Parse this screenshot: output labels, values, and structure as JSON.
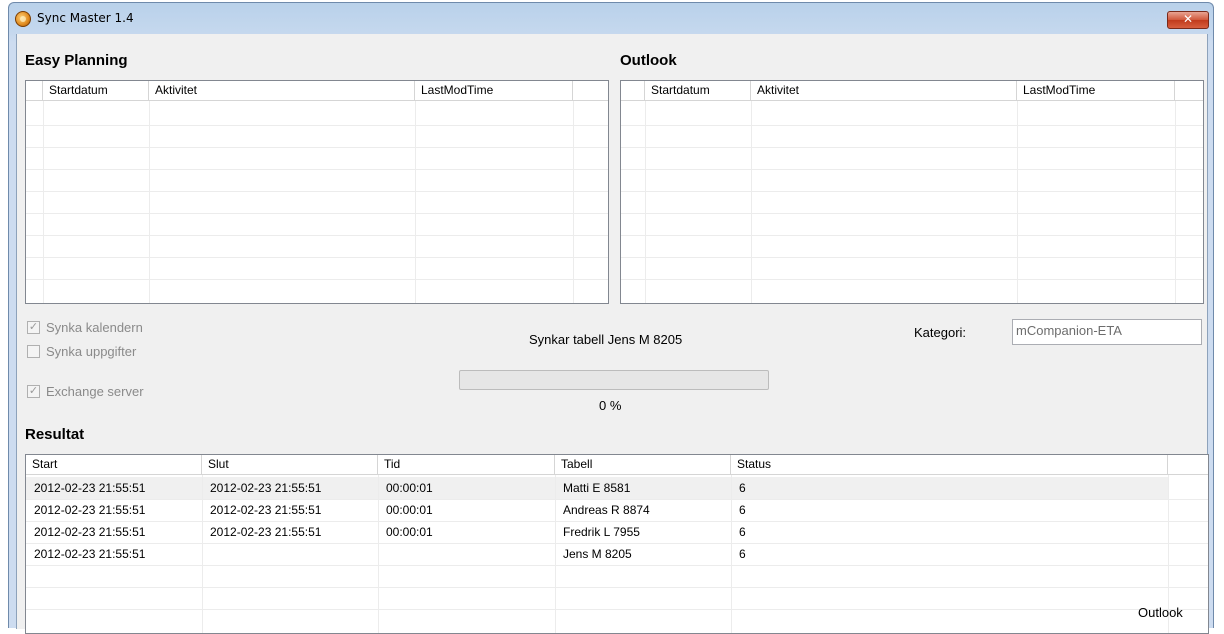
{
  "window": {
    "title": "Sync Master 1.4",
    "close_glyph": "✕"
  },
  "easy_planning": {
    "title": "Easy Planning",
    "columns": [
      "Startdatum",
      "Aktivitet",
      "LastModTime"
    ]
  },
  "outlook": {
    "title": "Outlook",
    "columns": [
      "Startdatum",
      "Aktivitet",
      "LastModTime"
    ]
  },
  "options": {
    "synka_kalendern": {
      "label": "Synka kalendern",
      "checked": true
    },
    "synka_uppgifter": {
      "label": "Synka uppgifter",
      "checked": false
    },
    "exchange_server": {
      "label": "Exchange server",
      "checked": true
    }
  },
  "status": {
    "text": "Synkar tabell Jens M 8205",
    "progress_percent": 0,
    "progress_label": "0 %"
  },
  "kategori": {
    "label": "Kategori:",
    "value": "mCompanion-ETA"
  },
  "resultat": {
    "title": "Resultat",
    "columns": [
      "Start",
      "Slut",
      "Tid",
      "Tabell",
      "Status"
    ],
    "rows": [
      {
        "start": "2012-02-23 21:55:51",
        "slut": "2012-02-23 21:55:51",
        "tid": "00:00:01",
        "tabell": "Matti E 8581",
        "status": "6"
      },
      {
        "start": "2012-02-23 21:55:51",
        "slut": "2012-02-23 21:55:51",
        "tid": "00:00:01",
        "tabell": "Andreas R 8874",
        "status": "6"
      },
      {
        "start": "2012-02-23 21:55:51",
        "slut": "2012-02-23 21:55:51",
        "tid": "00:00:01",
        "tabell": "Fredrik L 7955",
        "status": "6"
      },
      {
        "start": "2012-02-23 21:55:51",
        "slut": "",
        "tid": "",
        "tabell": "Jens M 8205",
        "status": "6"
      }
    ]
  },
  "footer": {
    "text": "Outlook"
  },
  "colors": {
    "title_bar": "#c5d8ee",
    "close_button": "#c9452a",
    "client_bg": "#f0f0f0"
  },
  "icons": {
    "app": "sync-master-app-icon",
    "close": "close-icon",
    "check": "checkmark-icon"
  }
}
